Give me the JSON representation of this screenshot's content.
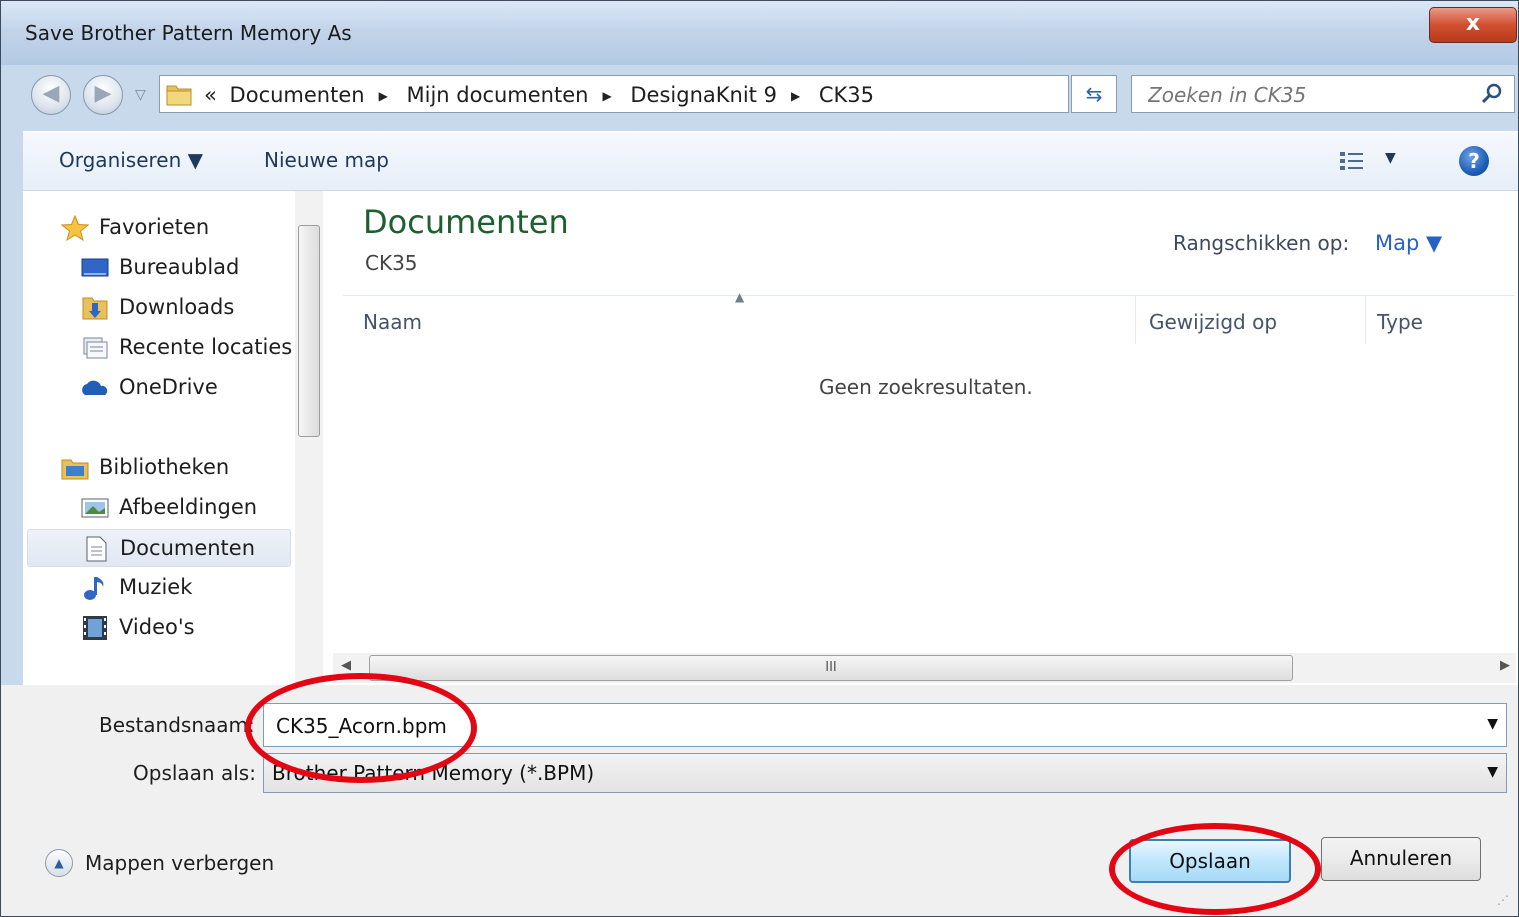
{
  "window": {
    "title": "Save Brother Pattern Memory As",
    "close_label": "x"
  },
  "nav_buttons": {
    "back_glyph": "◀",
    "forward_glyph": "▶",
    "history_glyph": "▽"
  },
  "address": {
    "prefix": "«",
    "crumbs": [
      "Documenten",
      "Mijn documenten",
      "DesignaKnit 9",
      "CK35"
    ],
    "separator": "▶",
    "dropdown_glyph": "▼",
    "refresh_glyph": "⇆"
  },
  "search": {
    "placeholder": "Zoeken in CK35"
  },
  "toolbar": {
    "organize_label": "Organiseren ▼",
    "new_folder_label": "Nieuwe map",
    "view_dropdown_glyph": "▼",
    "help_glyph": "?"
  },
  "sidebar": {
    "favorites": {
      "label": "Favorieten",
      "items": [
        {
          "label": "Bureaublad",
          "icon": "desktop-icon"
        },
        {
          "label": "Downloads",
          "icon": "downloads-icon"
        },
        {
          "label": "Recente locaties",
          "icon": "recent-places-icon"
        },
        {
          "label": "OneDrive",
          "icon": "onedrive-icon"
        }
      ]
    },
    "libraries": {
      "label": "Bibliotheken",
      "items": [
        {
          "label": "Afbeeldingen",
          "icon": "pictures-icon"
        },
        {
          "label": "Documenten",
          "icon": "documents-icon",
          "selected": true
        },
        {
          "label": "Muziek",
          "icon": "music-icon"
        },
        {
          "label": "Video's",
          "icon": "videos-icon"
        }
      ]
    }
  },
  "main": {
    "library_title": "Documenten",
    "library_subtitle": "CK35",
    "arrange_label": "Rangschikken op:",
    "arrange_value": "Map ▼",
    "columns": [
      "Naam",
      "Gewijzigd op",
      "Type"
    ],
    "empty_message": "Geen zoekresultaten.",
    "hscroll_grip": "III"
  },
  "form": {
    "filename_label": "Bestandsnaam:",
    "filename_value": "CK35_Acorn.bpm",
    "filetype_label": "Opslaan als:",
    "filetype_value": "Brother Pattern Memory (*.BPM)",
    "dropdown_glyph": "▼"
  },
  "footer": {
    "hide_folders_label": "Mappen verbergen",
    "save_label": "Opslaan",
    "cancel_label": "Annuleren"
  },
  "colors": {
    "annotation": "#e30613",
    "library_title": "#1d5f2e",
    "link_blue": "#2661c6"
  }
}
